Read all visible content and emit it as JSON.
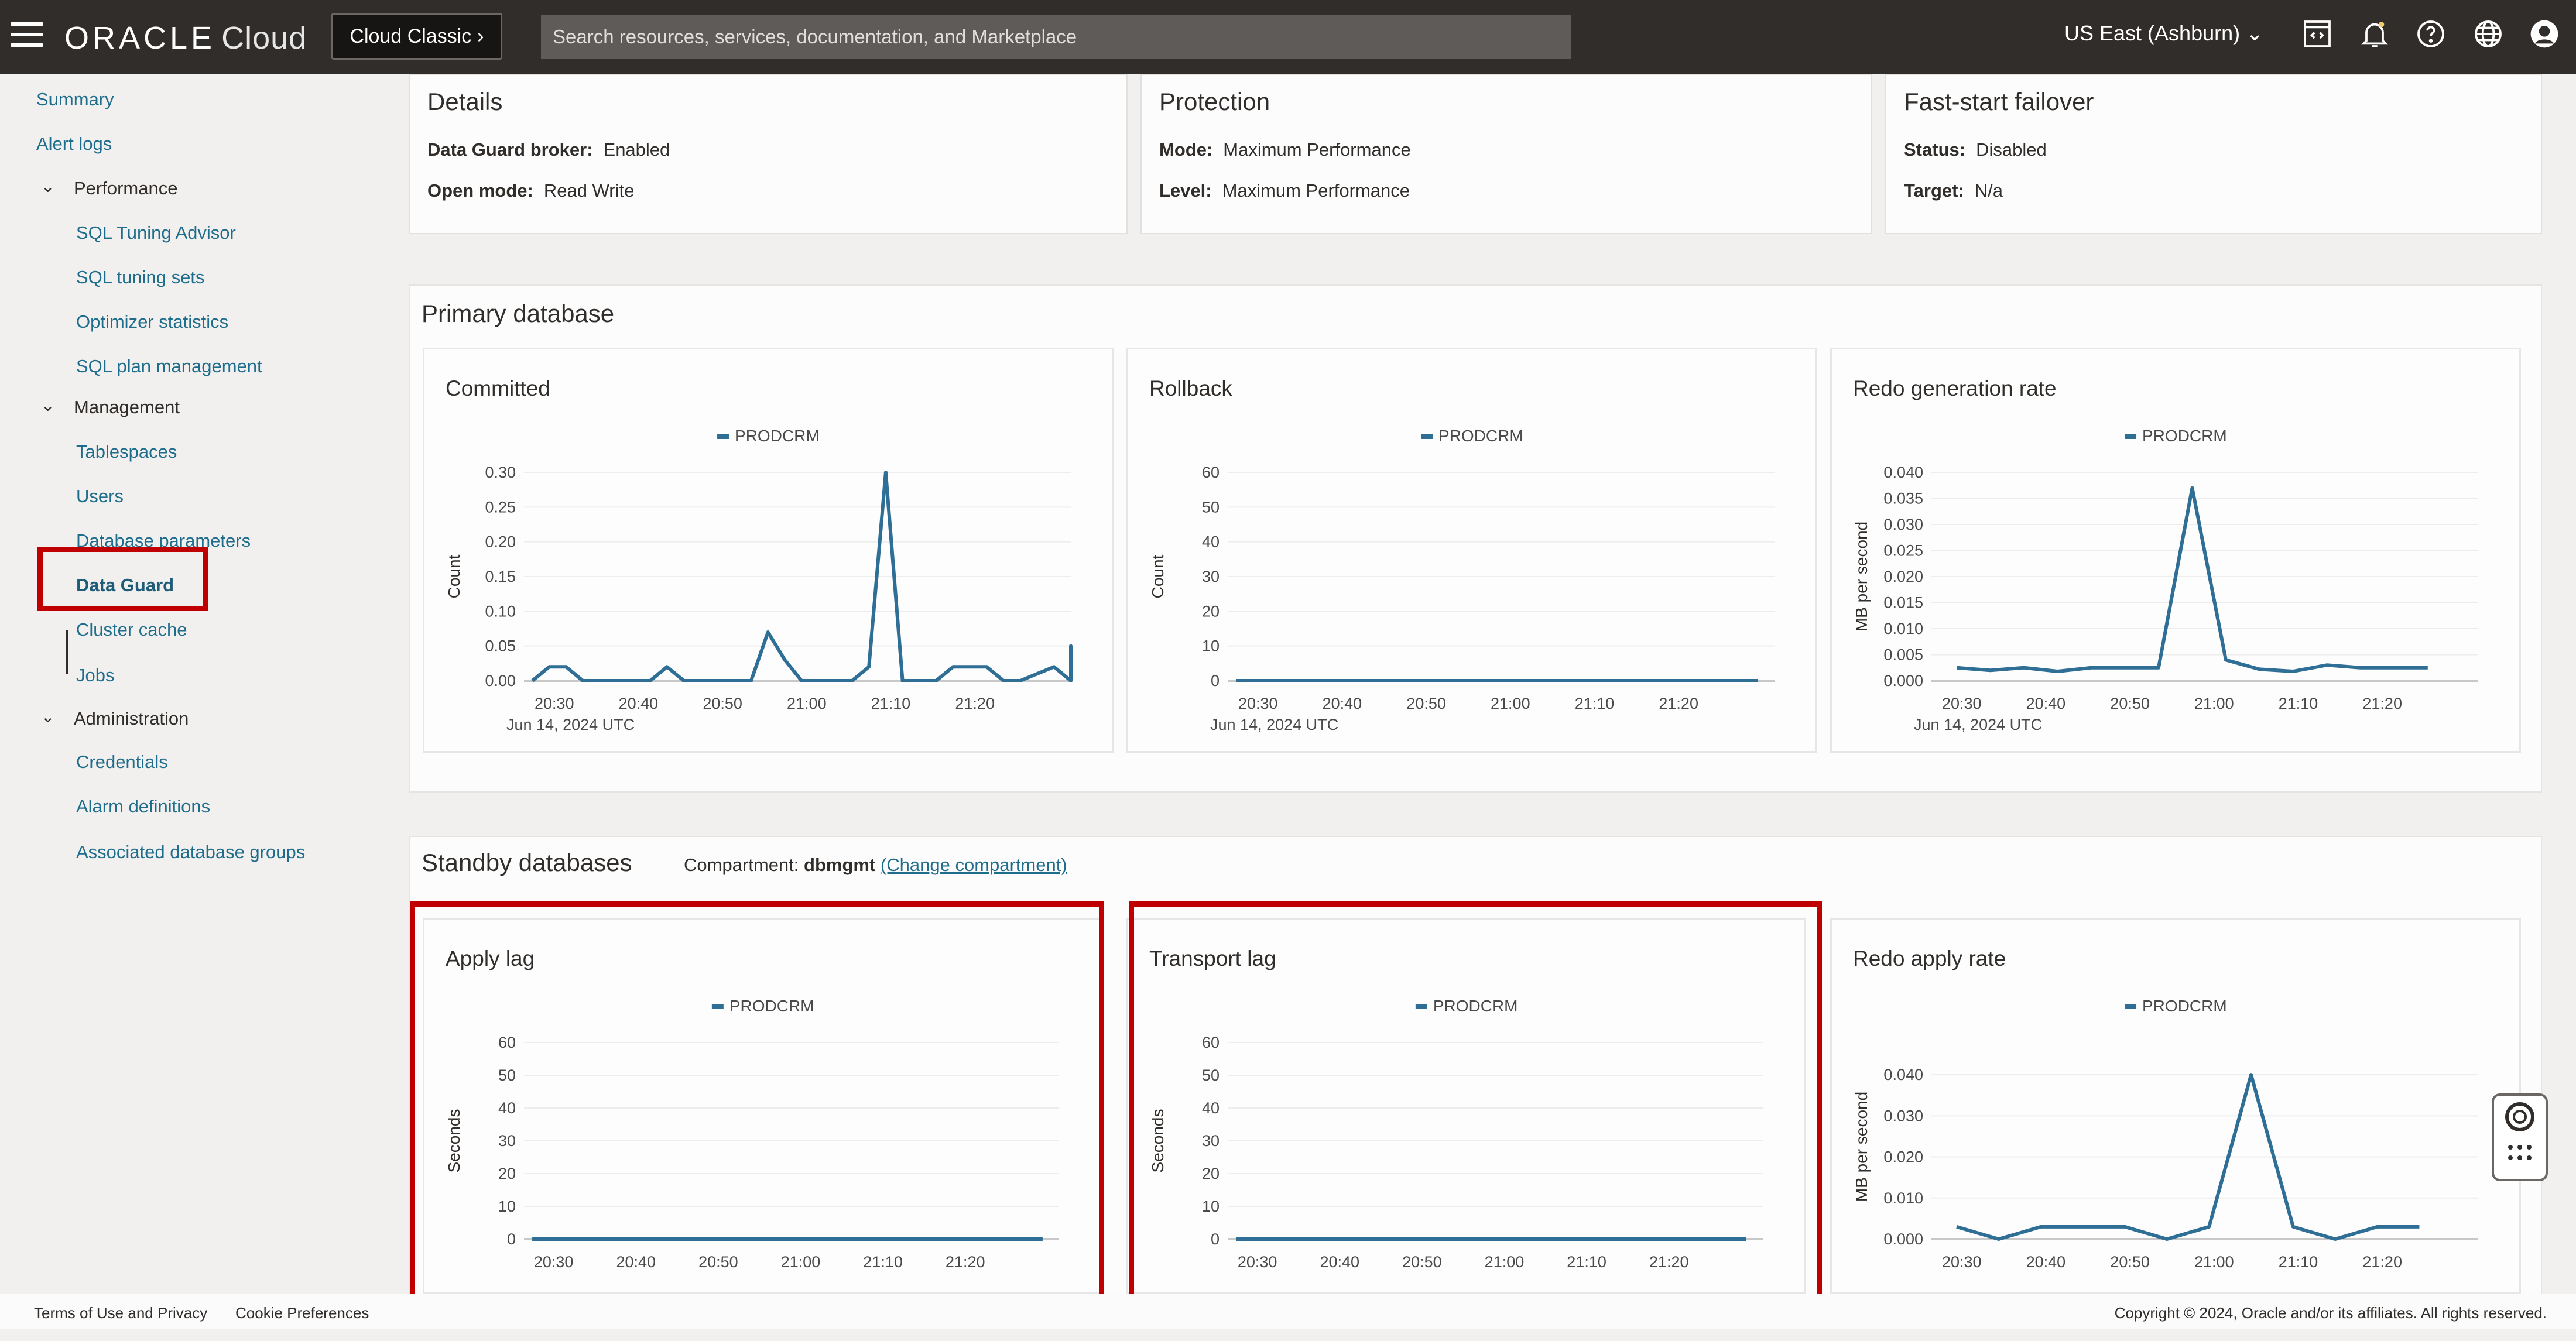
{
  "header": {
    "brand": "ORACLE",
    "brand_suffix": "Cloud",
    "classic_button": "Cloud Classic",
    "search_placeholder": "Search resources, services, documentation, and Marketplace",
    "region": "US East (Ashburn)",
    "icons": [
      "code-editor-icon",
      "bell-icon",
      "help-icon",
      "globe-icon",
      "profile-icon"
    ]
  },
  "sidebar": {
    "items": [
      {
        "label": "Summary",
        "type": "top"
      },
      {
        "label": "Alert logs",
        "type": "top"
      },
      {
        "label": "Performance",
        "type": "group"
      },
      {
        "label": "SQL Tuning Advisor",
        "type": "sub"
      },
      {
        "label": "SQL tuning sets",
        "type": "sub"
      },
      {
        "label": "Optimizer statistics",
        "type": "sub"
      },
      {
        "label": "SQL plan management",
        "type": "sub"
      },
      {
        "label": "Management",
        "type": "group"
      },
      {
        "label": "Tablespaces",
        "type": "sub"
      },
      {
        "label": "Users",
        "type": "sub"
      },
      {
        "label": "Database parameters",
        "type": "sub"
      },
      {
        "label": "Data Guard",
        "type": "sub",
        "active": true
      },
      {
        "label": "Cluster cache",
        "type": "sub"
      },
      {
        "label": "Jobs",
        "type": "sub"
      },
      {
        "label": "Administration",
        "type": "group"
      },
      {
        "label": "Credentials",
        "type": "sub"
      },
      {
        "label": "Alarm definitions",
        "type": "sub"
      },
      {
        "label": "Associated database groups",
        "type": "sub"
      }
    ]
  },
  "details": {
    "title": "Details",
    "broker_label": "Data Guard broker:",
    "broker_value": "Enabled",
    "open_mode_label": "Open mode:",
    "open_mode_value": "Read Write"
  },
  "protection": {
    "title": "Protection",
    "mode_label": "Mode:",
    "mode_value": "Maximum Performance",
    "level_label": "Level:",
    "level_value": "Maximum Performance"
  },
  "failover": {
    "title": "Fast-start failover",
    "status_label": "Status:",
    "status_value": "Disabled",
    "target_label": "Target:",
    "target_value": "N/a"
  },
  "primary": {
    "title": "Primary database"
  },
  "standby": {
    "title": "Standby databases",
    "compartment_label": "Compartment:",
    "compartment_value": "dbmgmt",
    "change_link": "(Change compartment)"
  },
  "footer": {
    "terms": "Terms of Use and Privacy",
    "cookies": "Cookie Preferences",
    "copyright": "Copyright © 2024, Oracle and/or its affiliates. All rights reserved."
  },
  "colors": {
    "line": "#2f6f95",
    "highlight": "#c00000"
  },
  "chart_data": [
    {
      "id": "committed",
      "type": "line",
      "title": "Committed",
      "ylabel": "Count",
      "legend": "PRODCRM",
      "legend_position": "top-center",
      "xticks": [
        "20:30",
        "20:40",
        "20:50",
        "21:00",
        "21:10",
        "21:20"
      ],
      "xsub": "Jun 14, 2024 UTC",
      "yticks": [
        "0.00",
        "0.05",
        "0.10",
        "0.15",
        "0.20",
        "0.25",
        "0.30"
      ],
      "ylim": [
        0,
        0.3
      ],
      "xlim": [
        -1.5,
        31
      ],
      "x": [
        -1,
        0,
        1,
        2,
        6,
        7,
        8,
        12,
        13,
        14,
        15,
        18,
        19,
        20,
        21,
        22,
        23,
        24,
        26,
        27,
        28,
        30,
        31,
        32,
        33,
        34
      ],
      "values": [
        0,
        0.02,
        0.02,
        0,
        0,
        0.02,
        0,
        0,
        0.07,
        0.03,
        0,
        0,
        0.02,
        0.3,
        0,
        0,
        0,
        0.02,
        0.02,
        0,
        0,
        0.02,
        0,
        0.05,
        0.02,
        0
      ]
    },
    {
      "id": "rollback",
      "type": "line",
      "title": "Rollback",
      "ylabel": "Count",
      "legend": "PRODCRM",
      "legend_position": "top-center",
      "xticks": [
        "20:30",
        "20:40",
        "20:50",
        "21:00",
        "21:10",
        "21:20"
      ],
      "xsub": "Jun 14, 2024 UTC",
      "yticks": [
        "0",
        "10",
        "20",
        "30",
        "40",
        "50",
        "60"
      ],
      "ylim": [
        0,
        60
      ],
      "xlim": [
        -1.5,
        31
      ],
      "x": [
        -1,
        30
      ],
      "values": [
        0,
        0
      ]
    },
    {
      "id": "redo_gen",
      "type": "line",
      "title": "Redo generation rate",
      "ylabel": "MB per second",
      "legend": "PRODCRM",
      "legend_position": "top-center",
      "xticks": [
        "20:30",
        "20:40",
        "20:50",
        "21:00",
        "21:10",
        "21:20"
      ],
      "xsub": "Jun 14, 2024 UTC",
      "yticks": [
        "0.000",
        "0.005",
        "0.010",
        "0.015",
        "0.020",
        "0.025",
        "0.030",
        "0.035",
        "0.040"
      ],
      "ylim": [
        0,
        0.04
      ],
      "xlim": [
        -1.5,
        31
      ],
      "x": [
        0,
        2,
        4,
        6,
        8,
        10,
        12,
        14,
        16,
        18,
        20,
        22,
        24,
        26,
        28
      ],
      "values": [
        0.0025,
        0.002,
        0.0025,
        0.0018,
        0.0025,
        0.0025,
        0.0025,
        0.037,
        0.004,
        0.0022,
        0.0018,
        0.003,
        0.0025,
        0.0025,
        0.0025
      ]
    },
    {
      "id": "apply_lag",
      "type": "line",
      "title": "Apply lag",
      "ylabel": "Seconds",
      "legend": "PRODCRM",
      "legend_position": "top-center",
      "xticks": [
        "20:30",
        "20:40",
        "20:50",
        "21:00",
        "21:10",
        "21:20"
      ],
      "xsub": "",
      "yticks": [
        "0",
        "10",
        "20",
        "30",
        "40",
        "50",
        "60"
      ],
      "ylim": [
        0,
        60
      ],
      "xlim": [
        -1.5,
        31
      ],
      "x": [
        -1,
        30
      ],
      "values": [
        0,
        0
      ]
    },
    {
      "id": "transport_lag",
      "type": "line",
      "title": "Transport lag",
      "ylabel": "Seconds",
      "legend": "PRODCRM",
      "legend_position": "top-center",
      "xticks": [
        "20:30",
        "20:40",
        "20:50",
        "21:00",
        "21:10",
        "21:20"
      ],
      "xsub": "",
      "yticks": [
        "0",
        "10",
        "20",
        "30",
        "40",
        "50",
        "60"
      ],
      "ylim": [
        0,
        60
      ],
      "xlim": [
        -1.5,
        31
      ],
      "x": [
        -1,
        30
      ],
      "values": [
        0,
        0
      ]
    },
    {
      "id": "redo_apply",
      "type": "line",
      "title": "Redo apply rate",
      "ylabel": "MB per second",
      "legend": "PRODCRM",
      "legend_position": "top-center",
      "xticks": [
        "20:30",
        "20:40",
        "20:50",
        "21:00",
        "21:10",
        "21:20"
      ],
      "xsub": "",
      "yticks": [
        "0.000",
        "0.010",
        "0.020",
        "0.030",
        "0.040"
      ],
      "ylim": [
        0,
        0.045
      ],
      "xlim": [
        -1.5,
        31
      ],
      "x": [
        0,
        5,
        10,
        15,
        20,
        25,
        30,
        35,
        40,
        45,
        50,
        55
      ],
      "values": [
        0.003,
        0,
        0.003,
        0.003,
        0.003,
        0,
        0.003,
        0.04,
        0.003,
        0,
        0.003,
        0.003
      ],
      "xscale": 0.5
    }
  ]
}
